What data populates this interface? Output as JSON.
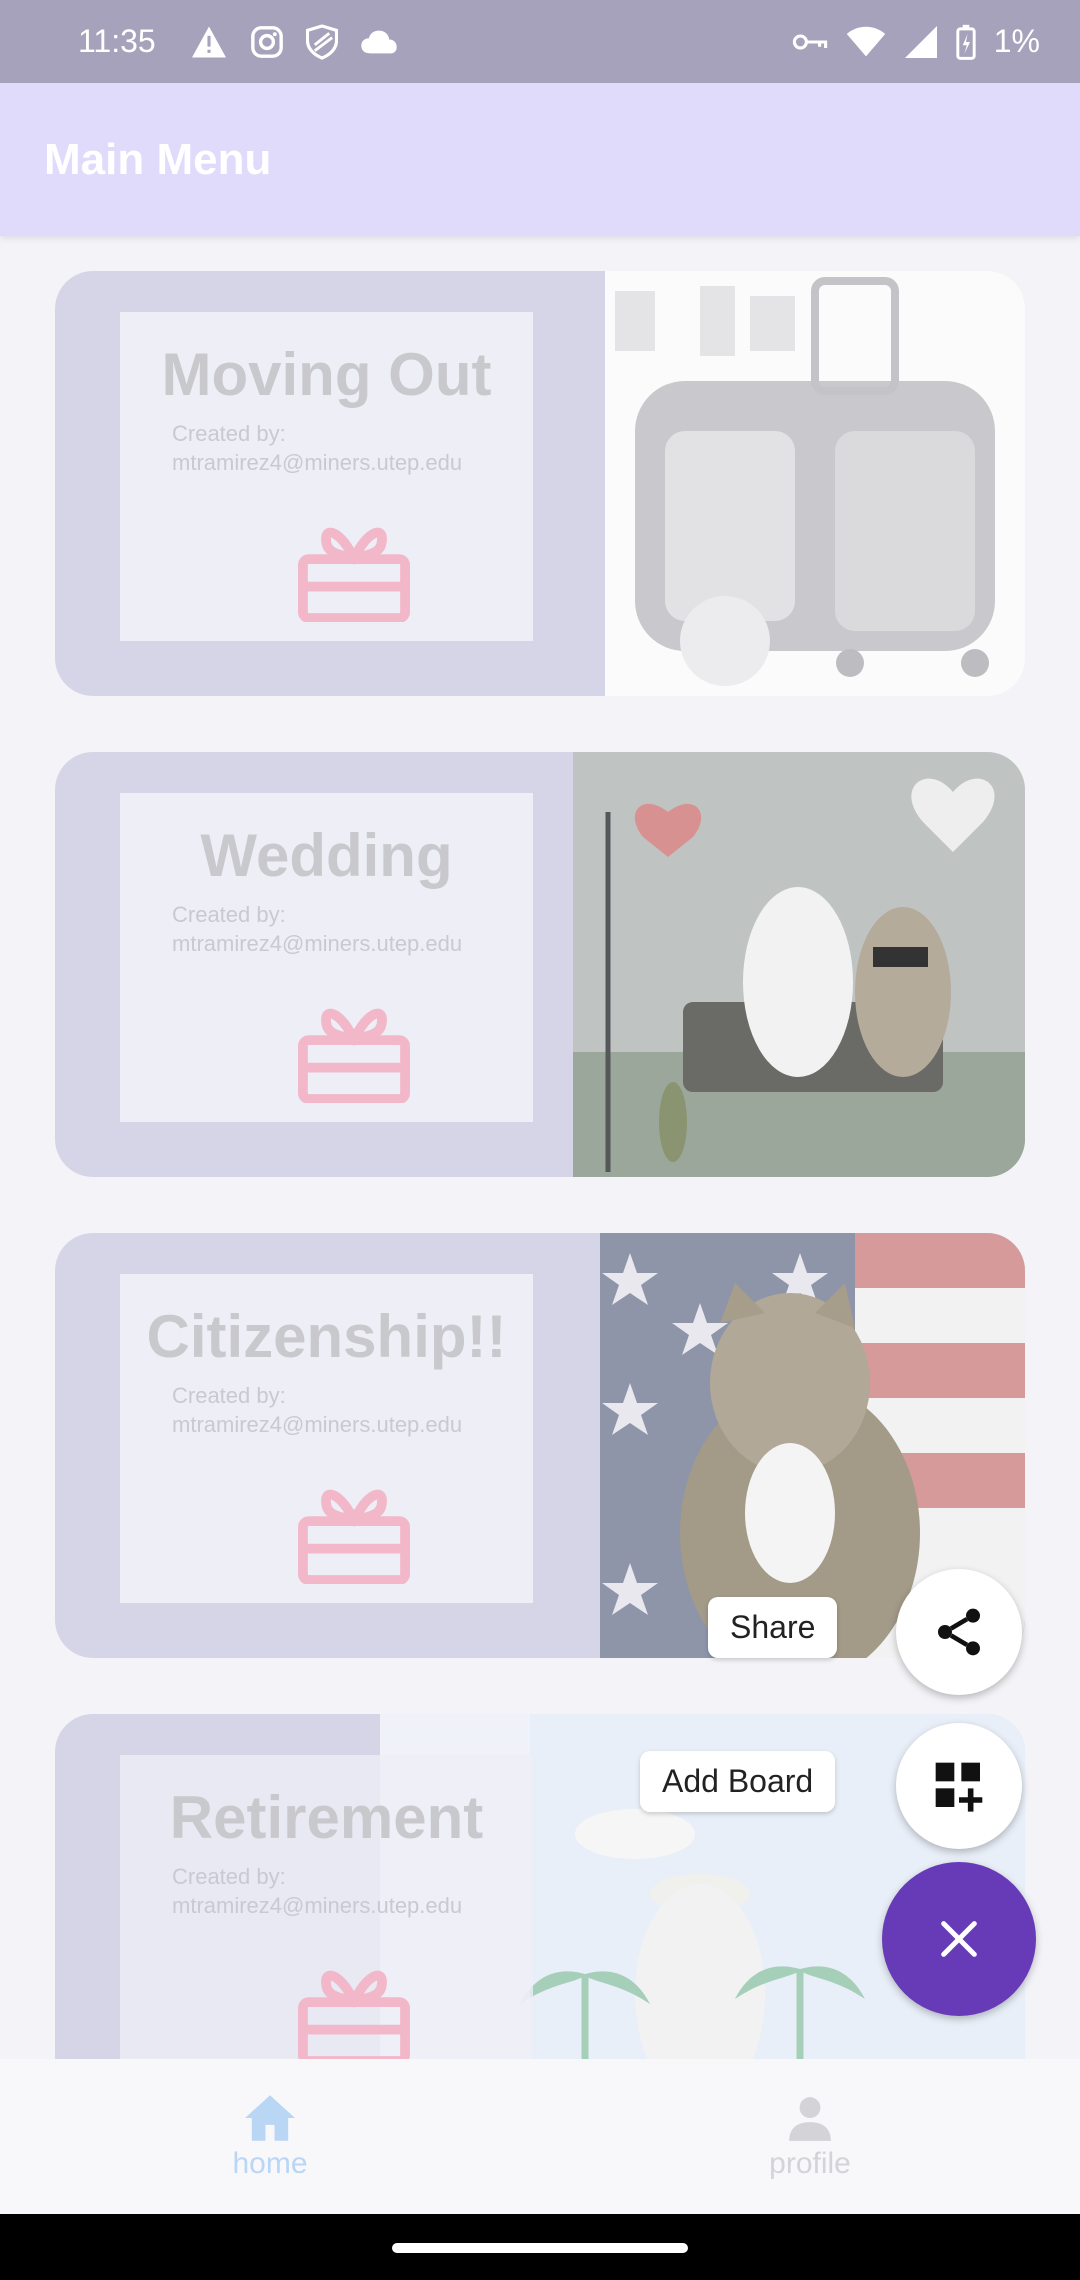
{
  "status_bar": {
    "time": "11:35",
    "battery": "1%",
    "icons_left": [
      "warning-icon",
      "instagram-icon",
      "shield-icon",
      "cloud-icon"
    ],
    "icons_right": [
      "vpn-key-icon",
      "wifi-icon",
      "signal-icon",
      "battery-charging-icon"
    ]
  },
  "appbar": {
    "title": "Main Menu"
  },
  "boards": [
    {
      "title": "Moving Out",
      "created_by_label": "Created by:",
      "creator": "mtramirez4@miners.utep.edu",
      "image": "cat-carrier-photo"
    },
    {
      "title": "Wedding",
      "created_by_label": "Created by:",
      "creator": "mtramirez4@miners.utep.edu",
      "image": "cat-wedding-photo"
    },
    {
      "title": "Citizenship!!",
      "created_by_label": "Created by:",
      "creator": "mtramirez4@miners.utep.edu",
      "image": "cat-flag-photo"
    },
    {
      "title": "Retirement",
      "created_by_label": "Created by:",
      "creator": "mtramirez4@miners.utep.edu",
      "image": "cat-beach-photo"
    }
  ],
  "fab_menu": {
    "share_label": "Share",
    "add_board_label": "Add Board"
  },
  "bottom_nav": {
    "home_label": "home",
    "profile_label": "profile"
  },
  "colors": {
    "accent": "#673ab7",
    "appbar": "#e0dbfa",
    "status_bar": "#a6a2bb",
    "card_bg": "#d6d5e8",
    "gift_icon": "#f2b8c9",
    "nav_active": "#b9d6f5"
  }
}
